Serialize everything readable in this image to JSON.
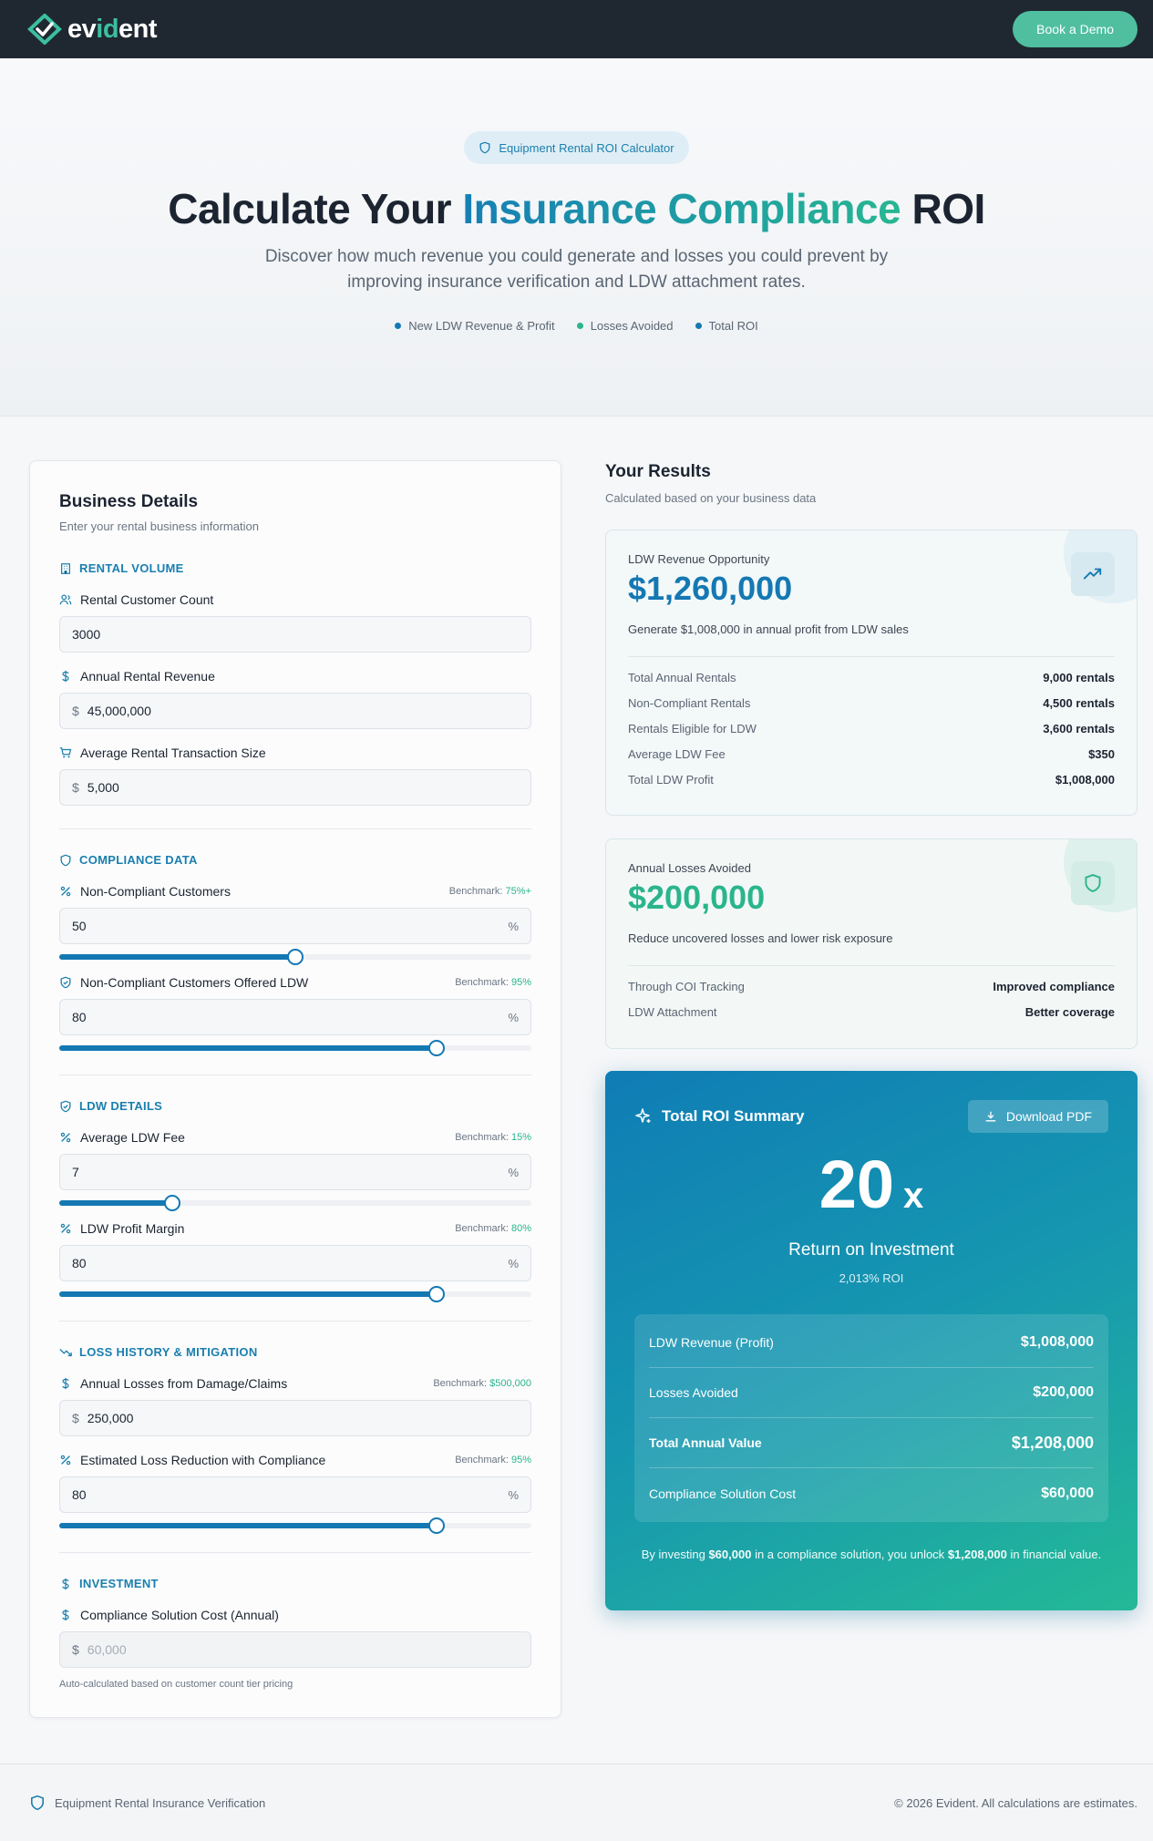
{
  "nav": {
    "logo_pre": "ev",
    "logo_hl": "id",
    "logo_post": "ent",
    "demo_label": "Book a Demo"
  },
  "hero": {
    "pill": "Equipment Rental ROI Calculator",
    "title_a": "Calculate Your ",
    "title_b": "Insurance Compliance",
    "title_c": " ROI",
    "subtitle": "Discover how much revenue you could generate and losses you could prevent by improving insurance verification and LDW attachment rates.",
    "legend": [
      {
        "label": "New LDW Revenue & Profit",
        "color": "#1478b3"
      },
      {
        "label": "Losses Avoided",
        "color": "#2bb58c"
      },
      {
        "label": "Total ROI",
        "color": "#1478b3"
      }
    ]
  },
  "form": {
    "title": "Business Details",
    "subtitle": "Enter your rental business information",
    "sections": {
      "rental_volume": "RENTAL VOLUME",
      "compliance": "COMPLIANCE DATA",
      "ldw": "LDW DETAILS",
      "loss": "LOSS HISTORY & MITIGATION",
      "investment": "INVESTMENT"
    },
    "fields": {
      "customer_count": {
        "label": "Rental Customer Count",
        "value": "3000"
      },
      "annual_revenue": {
        "label": "Annual Rental Revenue",
        "prefix": "$",
        "value": "45,000,000"
      },
      "avg_transaction": {
        "label": "Average Rental Transaction Size",
        "prefix": "$",
        "value": "5,000"
      },
      "non_compliant": {
        "label": "Non-Compliant Customers",
        "bm_label": "Benchmark:",
        "bm_value": "75%+",
        "value": "50",
        "suffix": "%",
        "slider": 0.5
      },
      "offered_ldw": {
        "label": "Non-Compliant Customers Offered LDW",
        "bm_label": "Benchmark:",
        "bm_value": "95%",
        "value": "80",
        "suffix": "%",
        "slider": 0.8
      },
      "ldw_fee": {
        "label": "Average LDW Fee",
        "bm_label": "Benchmark:",
        "bm_value": "15%",
        "value": "7",
        "suffix": "%",
        "slider": 0.24
      },
      "ldw_margin": {
        "label": "LDW Profit Margin",
        "bm_label": "Benchmark:",
        "bm_value": "80%",
        "value": "80",
        "suffix": "%",
        "slider": 0.8
      },
      "annual_losses": {
        "label": "Annual Losses from Damage/Claims",
        "bm_label": "Benchmark:",
        "bm_value": "$500,000",
        "prefix": "$",
        "value": "250,000"
      },
      "loss_reduction": {
        "label": "Estimated Loss Reduction with Compliance",
        "bm_label": "Benchmark:",
        "bm_value": "95%",
        "value": "80",
        "suffix": "%",
        "slider": 0.8
      },
      "solution_cost": {
        "label": "Compliance Solution Cost (Annual)",
        "prefix": "$",
        "value": "60,000",
        "note": "Auto-calculated based on customer count tier pricing"
      }
    }
  },
  "results": {
    "title": "Your Results",
    "subtitle": "Calculated based on your business data",
    "ldw": {
      "label": "LDW Revenue Opportunity",
      "value": "$1,260,000",
      "desc": "Generate $1,008,000 in annual profit from LDW sales",
      "rows": [
        {
          "k": "Total Annual Rentals",
          "v": "9,000 rentals"
        },
        {
          "k": "Non-Compliant Rentals",
          "v": "4,500 rentals"
        },
        {
          "k": "Rentals Eligible for LDW",
          "v": "3,600 rentals"
        },
        {
          "k": "Average LDW Fee",
          "v": "$350"
        },
        {
          "k": "Total LDW Profit",
          "v": "$1,008,000"
        }
      ]
    },
    "losses": {
      "label": "Annual Losses Avoided",
      "value": "$200,000",
      "desc": "Reduce uncovered losses and lower risk exposure",
      "rows": [
        {
          "k": "Through COI Tracking",
          "v": "Improved compliance"
        },
        {
          "k": "LDW Attachment",
          "v": "Better coverage"
        }
      ]
    },
    "roi": {
      "title": "Total ROI Summary",
      "pdf_label": "Download PDF",
      "multiple": "20",
      "multiple_suffix": "x",
      "label": "Return on Investment",
      "pct": "2,013% ROI",
      "rows": [
        {
          "k": "LDW Revenue (Profit)",
          "v": "$1,008,000"
        },
        {
          "k": "Losses Avoided",
          "v": "$200,000"
        },
        {
          "k": "Total Annual Value",
          "v": "$1,208,000"
        },
        {
          "k": "Compliance Solution Cost",
          "v": "$60,000"
        }
      ],
      "note_a": "By investing ",
      "note_b": "$60,000",
      "note_c": " in a compliance solution, you unlock ",
      "note_d": "$1,208,000",
      "note_e": " in financial value."
    }
  },
  "footer": {
    "left": "Equipment Rental Insurance Verification",
    "right": "© 2026 Evident. All calculations are estimates."
  },
  "colors": {
    "primary": "#1478b3",
    "accent": "#2bb58c",
    "nav_bg": "#1f2830"
  }
}
